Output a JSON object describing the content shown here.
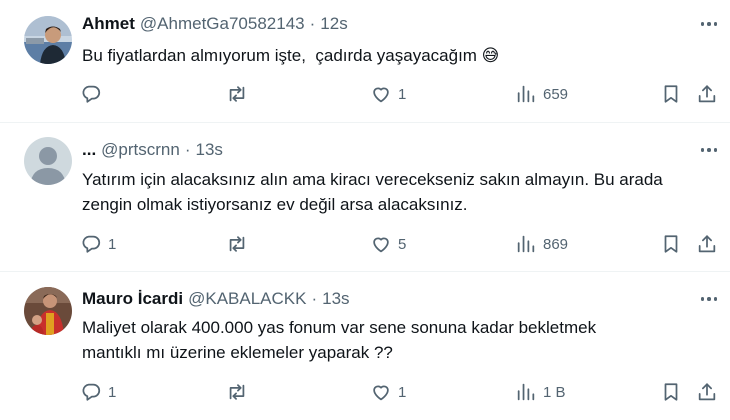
{
  "tweets": [
    {
      "name": "Ahmet",
      "handle": "@AhmetGa70582143",
      "separator": "·",
      "time": "12s",
      "text": "Bu fiyatlardan almıyorum işte,  çadırda yaşayacağım 😅",
      "replies": "",
      "retweets": "",
      "likes": "1",
      "views": "659",
      "avatar": "photo-avatar"
    },
    {
      "name": "...",
      "handle": "@prtscrnn",
      "separator": "·",
      "time": "13s",
      "text": "Yatırım için alacaksınız alın ama kiracı verecekseniz sakın almayın. Bu arada\nzengin olmak istiyorsanız ev değil arsa alacaksınız.",
      "replies": "1",
      "retweets": "",
      "likes": "5",
      "views": "869",
      "avatar": "default-avatar"
    },
    {
      "name": "Mauro İcardi",
      "handle": "@KABALACKK",
      "separator": "·",
      "time": "13s",
      "text": "Maliyet olarak 400.000 yas fonum var sene sonuna kadar bekletmek\nmantıklı mı üzerine eklemeler yaparak ??",
      "replies": "1",
      "retweets": "",
      "likes": "1",
      "views": "1 B",
      "avatar": "photo-avatar"
    }
  ],
  "icons": {
    "reply": "reply-icon",
    "retweet": "retweet-icon",
    "like": "heart-icon",
    "views": "views-chart-icon",
    "bookmark": "bookmark-icon",
    "share": "share-icon",
    "more": "more-dots-icon"
  },
  "colors": {
    "text": "#0f1419",
    "secondary": "#536471",
    "divider": "#eff3f4",
    "background": "#ffffff"
  }
}
